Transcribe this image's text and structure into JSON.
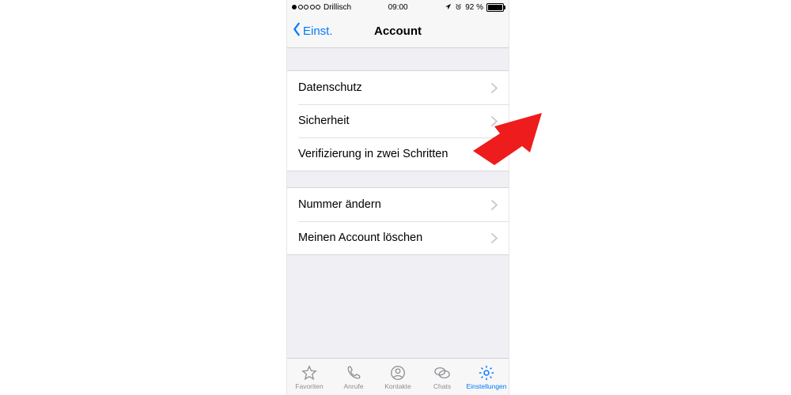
{
  "statusbar": {
    "carrier": "Drillisch",
    "time": "09:00",
    "battery_pct": "92 %"
  },
  "nav": {
    "back_label": "Einst.",
    "title": "Account"
  },
  "group1": {
    "items": [
      {
        "label": "Datenschutz"
      },
      {
        "label": "Sicherheit"
      },
      {
        "label": "Verifizierung in zwei Schritten"
      }
    ]
  },
  "group2": {
    "items": [
      {
        "label": "Nummer ändern"
      },
      {
        "label": "Meinen Account löschen"
      }
    ]
  },
  "tabs": {
    "favorites": "Favoriten",
    "calls": "Anrufe",
    "contacts": "Kontakte",
    "chats": "Chats",
    "settings": "Einstellungen"
  },
  "colors": {
    "accent": "#007aff",
    "annotation": "#ee1c1c"
  }
}
